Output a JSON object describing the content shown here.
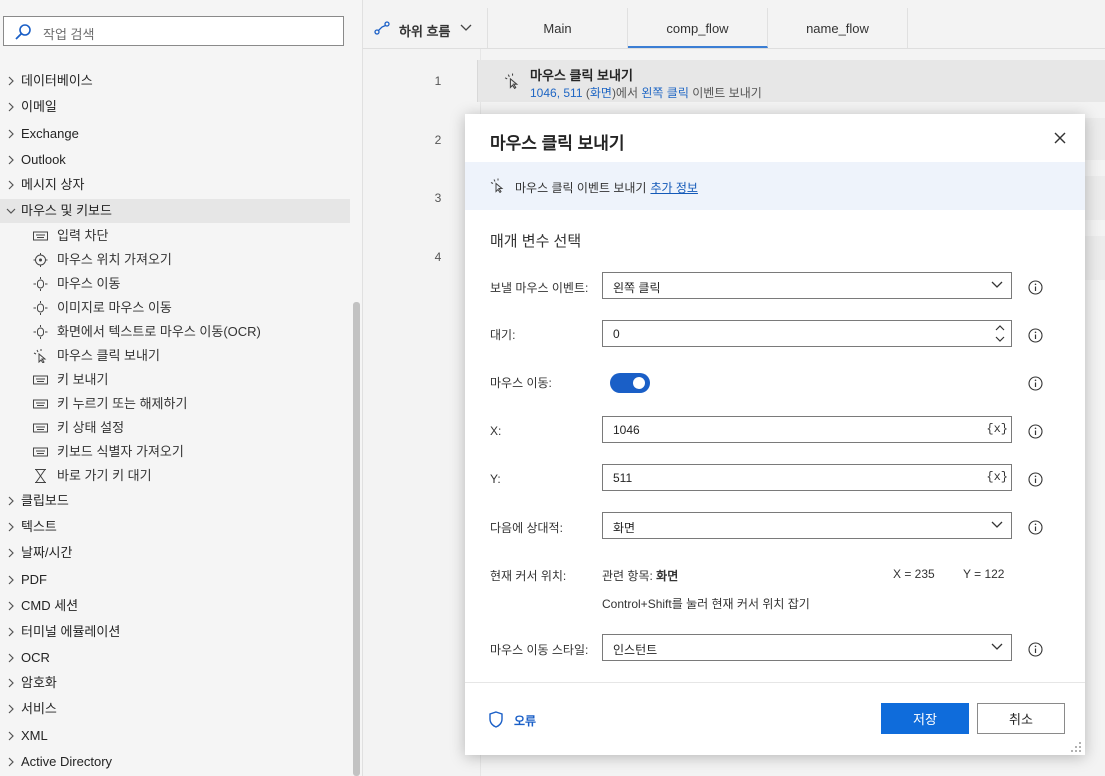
{
  "sidebar": {
    "search_placeholder": "작업 검색",
    "groups": [
      {
        "label": "데이터베이스"
      },
      {
        "label": "이메일"
      },
      {
        "label": "Exchange"
      },
      {
        "label": "Outlook"
      },
      {
        "label": "메시지 상자"
      },
      {
        "label": "마우스 및 키보드"
      }
    ],
    "mouse_keyboard_items": [
      {
        "label": "입력 차단",
        "icon": "keyboard-icon"
      },
      {
        "label": "마우스 위치 가져오기",
        "icon": "target-icon"
      },
      {
        "label": "마우스 이동",
        "icon": "mouse-move-icon"
      },
      {
        "label": "이미지로 마우스 이동",
        "icon": "mouse-move-icon"
      },
      {
        "label": "화면에서 텍스트로 마우스 이동(OCR)",
        "icon": "mouse-move-icon"
      },
      {
        "label": "마우스 클릭 보내기",
        "icon": "mouse-click-icon"
      },
      {
        "label": "키 보내기",
        "icon": "keyboard-icon"
      },
      {
        "label": "키 누르기 또는 해제하기",
        "icon": "keyboard-icon"
      },
      {
        "label": "키 상태 설정",
        "icon": "keyboard-icon"
      },
      {
        "label": "키보드 식별자 가져오기",
        "icon": "keyboard-icon"
      },
      {
        "label": "바로 가기 키 대기",
        "icon": "hourglass-icon"
      }
    ],
    "groups_after": [
      {
        "label": "클립보드"
      },
      {
        "label": "텍스트"
      },
      {
        "label": "날짜/시간"
      },
      {
        "label": "PDF"
      },
      {
        "label": "CMD 세션"
      },
      {
        "label": "터미널 에뮬레이션"
      },
      {
        "label": "OCR"
      },
      {
        "label": "암호화"
      },
      {
        "label": "서비스"
      },
      {
        "label": "XML"
      },
      {
        "label": "Active Directory"
      }
    ]
  },
  "editor": {
    "subflow_label": "하위 흐름",
    "tabs": [
      {
        "label": "Main"
      },
      {
        "label": "comp_flow"
      },
      {
        "label": "name_flow"
      }
    ],
    "active_tab": "comp_flow",
    "line_numbers": [
      "1",
      "2",
      "3",
      "4"
    ],
    "step1": {
      "title": "마우스 클릭 보내기",
      "desc_coords": "1046, 511",
      "desc_open": " (",
      "desc_screen": "화면",
      "desc_mid": ")에서 ",
      "desc_click": "왼쪽 클릭",
      "desc_end": " 이벤트 보내기"
    }
  },
  "dialog": {
    "title": "마우스 클릭 보내기",
    "info_text": "마우스 클릭 이벤트 보내기",
    "info_link": "추가 정보",
    "section_title": "매개 변수 선택",
    "fields": {
      "event_label": "보낼 마우스 이벤트:",
      "event_value": "왼쪽 클릭",
      "wait_label": "대기:",
      "wait_value": "0",
      "move_label": "마우스 이동:",
      "move_on": true,
      "x_label": "X:",
      "x_value": "1046",
      "y_label": "Y:",
      "y_value": "511",
      "var_token": "{x}",
      "relative_label": "다음에 상대적:",
      "relative_value": "화면",
      "cursor_label": "현재 커서 위치:",
      "cursor_related_prefix": "관련 항목: ",
      "cursor_related_value": "화면",
      "cursor_x": "X = 235",
      "cursor_y": "Y = 122",
      "cursor_hint": "Control+Shift를 눌러 현재 커서 위치 잡기",
      "style_label": "마우스 이동 스타일:",
      "style_value": "인스턴트"
    },
    "error_label": "오류",
    "save_label": "저장",
    "cancel_label": "취소"
  },
  "colors": {
    "accent": "#0f6cdb",
    "toggle_on": "#1a5fc7",
    "info_bar": "#eef3fb",
    "link": "#1359b8"
  }
}
